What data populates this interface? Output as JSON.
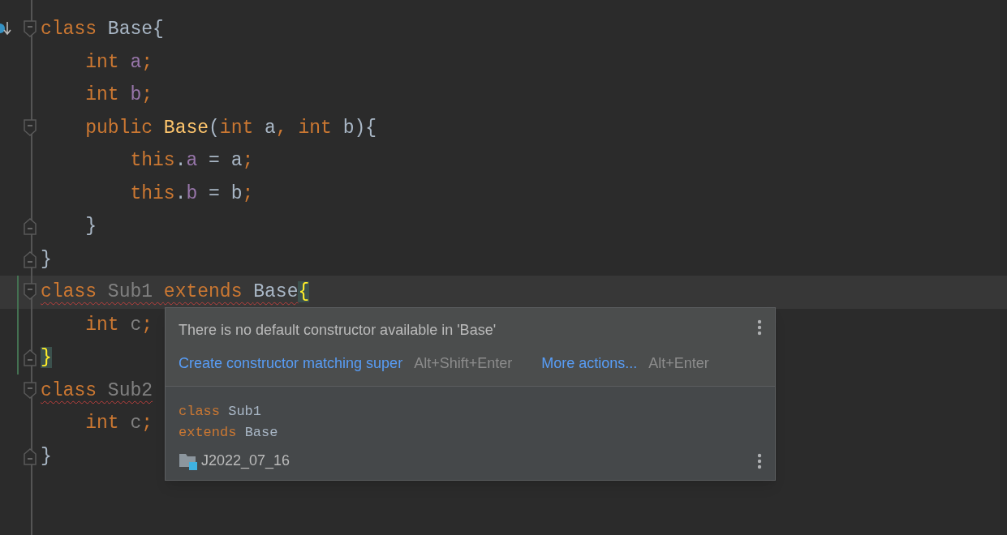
{
  "editor": {
    "lines": [
      {
        "fold_start": true,
        "fold_end": false,
        "override_marker": true,
        "current": false,
        "changed": false,
        "segments": [
          {
            "error": false,
            "tokens": [
              {
                "kind": "keyword",
                "text": "class "
              },
              {
                "kind": "ident",
                "text": "Base{"
              }
            ]
          }
        ]
      },
      {
        "fold_start": false,
        "fold_end": false,
        "override_marker": false,
        "current": false,
        "changed": false,
        "segments": [
          {
            "error": false,
            "tokens": [
              {
                "kind": "keyword",
                "text": "    int "
              },
              {
                "kind": "field",
                "text": "a"
              },
              {
                "kind": "keyword",
                "text": ";"
              }
            ]
          }
        ]
      },
      {
        "fold_start": false,
        "fold_end": false,
        "override_marker": false,
        "current": false,
        "changed": false,
        "segments": [
          {
            "error": false,
            "tokens": [
              {
                "kind": "keyword",
                "text": "    int "
              },
              {
                "kind": "field",
                "text": "b"
              },
              {
                "kind": "keyword",
                "text": ";"
              }
            ]
          }
        ]
      },
      {
        "fold_start": true,
        "fold_end": false,
        "override_marker": false,
        "current": false,
        "changed": false,
        "segments": [
          {
            "error": false,
            "tokens": [
              {
                "kind": "keyword",
                "text": "    public "
              },
              {
                "kind": "method",
                "text": "Base"
              },
              {
                "kind": "ident",
                "text": "("
              },
              {
                "kind": "keyword",
                "text": "int"
              },
              {
                "kind": "ident",
                "text": " a"
              },
              {
                "kind": "keyword",
                "text": ", int"
              },
              {
                "kind": "ident",
                "text": " b){"
              }
            ]
          }
        ]
      },
      {
        "fold_start": false,
        "fold_end": false,
        "override_marker": false,
        "current": false,
        "changed": false,
        "segments": [
          {
            "error": false,
            "tokens": [
              {
                "kind": "keyword",
                "text": "        this"
              },
              {
                "kind": "ident",
                "text": "."
              },
              {
                "kind": "field",
                "text": "a"
              },
              {
                "kind": "ident",
                "text": " = a"
              },
              {
                "kind": "keyword",
                "text": ";"
              }
            ]
          }
        ]
      },
      {
        "fold_start": false,
        "fold_end": false,
        "override_marker": false,
        "current": false,
        "changed": false,
        "segments": [
          {
            "error": false,
            "tokens": [
              {
                "kind": "keyword",
                "text": "        this"
              },
              {
                "kind": "ident",
                "text": "."
              },
              {
                "kind": "field",
                "text": "b"
              },
              {
                "kind": "ident",
                "text": " = b"
              },
              {
                "kind": "keyword",
                "text": ";"
              }
            ]
          }
        ]
      },
      {
        "fold_start": false,
        "fold_end": true,
        "override_marker": false,
        "current": false,
        "changed": false,
        "segments": [
          {
            "error": false,
            "tokens": [
              {
                "kind": "ident",
                "text": "    }"
              }
            ]
          }
        ]
      },
      {
        "fold_start": false,
        "fold_end": true,
        "override_marker": false,
        "current": false,
        "changed": false,
        "segments": [
          {
            "error": false,
            "tokens": [
              {
                "kind": "ident",
                "text": "}"
              }
            ]
          }
        ]
      },
      {
        "fold_start": true,
        "fold_end": false,
        "override_marker": false,
        "current": true,
        "changed": true,
        "segments": [
          {
            "error": true,
            "tokens": [
              {
                "kind": "keyword",
                "text": "class "
              },
              {
                "kind": "unused",
                "text": "Sub1 "
              },
              {
                "kind": "keyword",
                "text": "extends "
              },
              {
                "kind": "ident",
                "text": "Base"
              }
            ]
          },
          {
            "error": false,
            "tokens": [
              {
                "kind": "brace_match",
                "text": "{"
              }
            ]
          }
        ]
      },
      {
        "fold_start": false,
        "fold_end": false,
        "override_marker": false,
        "current": false,
        "changed": true,
        "segments": [
          {
            "error": false,
            "tokens": [
              {
                "kind": "keyword",
                "text": "    int "
              },
              {
                "kind": "unused",
                "text": "c"
              },
              {
                "kind": "keyword",
                "text": ";"
              }
            ]
          }
        ]
      },
      {
        "fold_start": false,
        "fold_end": true,
        "override_marker": false,
        "current": false,
        "changed": true,
        "segments": [
          {
            "error": false,
            "tokens": [
              {
                "kind": "brace_match",
                "text": "}"
              }
            ]
          }
        ]
      },
      {
        "fold_start": true,
        "fold_end": false,
        "override_marker": false,
        "current": false,
        "changed": false,
        "segments": [
          {
            "error": true,
            "tokens": [
              {
                "kind": "keyword",
                "text": "class "
              },
              {
                "kind": "unused",
                "text": "Sub2"
              }
            ]
          }
        ]
      },
      {
        "fold_start": false,
        "fold_end": false,
        "override_marker": false,
        "current": false,
        "changed": false,
        "segments": [
          {
            "error": false,
            "tokens": [
              {
                "kind": "keyword",
                "text": "    int "
              },
              {
                "kind": "unused",
                "text": "c"
              },
              {
                "kind": "keyword",
                "text": ";"
              }
            ]
          }
        ]
      },
      {
        "fold_start": false,
        "fold_end": true,
        "override_marker": false,
        "current": false,
        "changed": false,
        "segments": [
          {
            "error": false,
            "tokens": [
              {
                "kind": "ident",
                "text": "}"
              }
            ]
          }
        ]
      }
    ]
  },
  "popup": {
    "message": "There is no default constructor available in 'Base'",
    "actions": [
      {
        "label": "Create constructor matching super",
        "shortcut": "Alt+Shift+Enter"
      },
      {
        "label": "More actions...",
        "shortcut": "Alt+Enter"
      }
    ],
    "declaration": [
      [
        {
          "kind": "keyword",
          "text": "class "
        },
        {
          "kind": "ident",
          "text": "Sub1"
        }
      ],
      [
        {
          "kind": "keyword",
          "text": "extends "
        },
        {
          "kind": "ident",
          "text": "Base"
        }
      ]
    ],
    "module": "J2022_07_16"
  }
}
